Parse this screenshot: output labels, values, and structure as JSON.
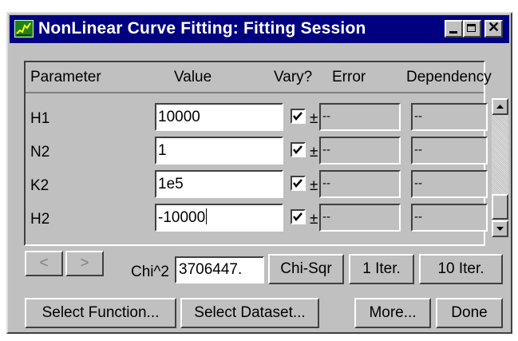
{
  "window": {
    "title": "NonLinear Curve Fitting:  Fitting Session",
    "controls": {
      "minimize": "minimize-button",
      "maximize": "maximize-button",
      "close": "close-button"
    }
  },
  "table": {
    "headers": {
      "parameter": "Parameter",
      "value": "Value",
      "vary": "Vary?",
      "error": "Error",
      "dependency": "Dependency"
    },
    "rows": [
      {
        "name": "H1",
        "value": "10000",
        "vary": true,
        "pm": "±",
        "error": "--",
        "dependency": "--"
      },
      {
        "name": "N2",
        "value": "1",
        "vary": true,
        "pm": "±",
        "error": "--",
        "dependency": "--"
      },
      {
        "name": "K2",
        "value": "1e5",
        "vary": true,
        "pm": "±",
        "error": "--",
        "dependency": "--"
      },
      {
        "name": "H2",
        "value": "-10000",
        "vary": true,
        "pm": "±",
        "error": "--",
        "dependency": "--"
      }
    ]
  },
  "nav": {
    "prev": "<",
    "next": ">"
  },
  "chi": {
    "label": "Chi^2",
    "value": "3706447."
  },
  "buttons": {
    "chi_sqr": "Chi-Sqr",
    "iter1": "1 Iter.",
    "iter10": "10 Iter.",
    "select_function": "Select Function...",
    "select_dataset": "Select Dataset...",
    "more": "More...",
    "done": "Done"
  },
  "colors": {
    "titlebar": "#000080",
    "face": "#c0c0c0",
    "field": "#ffffff"
  },
  "icons": {
    "app": "curve-fit-app-icon",
    "check": "checkmark-icon",
    "up": "scroll-up-arrow-icon",
    "down": "scroll-down-arrow-icon"
  }
}
